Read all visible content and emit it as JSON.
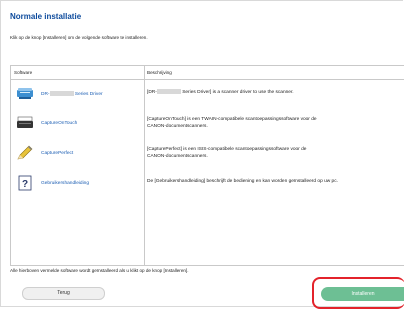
{
  "header": {
    "title": "Normale installatie",
    "instruction": "Klik op de knop [Installeren] om de volgende software te installeren."
  },
  "table": {
    "columns": [
      "Software",
      "Beschrijving"
    ],
    "rows": [
      {
        "icon": "scanner-icon",
        "name_prefix": "DR-",
        "name_suffix": " Series Driver",
        "desc_line1_prefix": "[DR-",
        "desc_line1_suffix": " Series Driver] is a scanner driver to use the scanner.",
        "desc_line2": ""
      },
      {
        "icon": "scanner-software-icon",
        "name": "CaptureOnTouch",
        "desc_line1": "[CaptureOnTouch] is een TWAIN-compatibele scantoepassingssoftware voor de",
        "desc_line2": "CANON-documentscanners."
      },
      {
        "icon": "pencil-icon",
        "name": "CapturePerfect",
        "desc_line1": "[CapturePerfect] is een ISIS-compatibele scantoepassingssoftware voor de",
        "desc_line2": "CANON-documentscanners."
      },
      {
        "icon": "manual-icon",
        "name": "Gebruikershandleiding",
        "desc_line1": "De [Gebruikershandleiding] beschrijft de bediening en kan worden geïnstalleerd op uw pc.",
        "desc_line2": ""
      }
    ]
  },
  "footer": {
    "note": "Alle hierboven vermelde software wordt geïnstalleerd als u klikt op de knop [Installeren].",
    "back_label": "Terug",
    "install_label": "Installeren"
  },
  "colors": {
    "title": "#0c4a9c",
    "link": "#1a5db3",
    "install_button": "#6dbf94",
    "highlight": "#e3232b"
  }
}
